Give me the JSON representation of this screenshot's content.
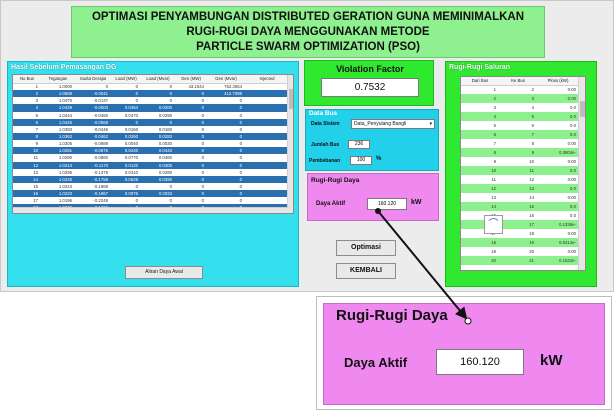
{
  "title": {
    "line1": "OPTIMASI PENYAMBUNGAN DISTRIBUTED GERATION GUNA MEMINIMALKAN",
    "line2": "RUGI-RUGI DAYA MENGGUNAKAN METODE",
    "line3": "PARTICLE SWARM OPTIMIZATION (PSO)"
  },
  "left_panel": {
    "title": "Hasil Sebelum Pemasangan DG",
    "columns": [
      "No Bus",
      "Tegangan",
      "Sudut Derajat",
      "Load (MW)",
      "Load (Mvar)",
      "Gen (MW)",
      "Gen (Mvar)",
      "Injected"
    ],
    "rows": [
      [
        "1",
        "1.0000",
        "0",
        "0",
        "0",
        "43.1544",
        "762.3564",
        ""
      ],
      [
        "2",
        "1.0668",
        "-0.0041",
        "0",
        "0",
        "0",
        "412.7098",
        ""
      ],
      [
        "3",
        "1.0470",
        "-0.0137",
        "0",
        "0",
        "0",
        "0",
        ""
      ],
      [
        "4",
        "1.0439",
        "-0.0003",
        "0.0464",
        "0.0200",
        "0",
        "0",
        ""
      ],
      [
        "5",
        "1.0444",
        "-0.0460",
        "0.0470",
        "0.0290",
        "0",
        "0",
        ""
      ],
      [
        "6",
        "1.0426",
        "-0.0568",
        "0",
        "0",
        "0",
        "0",
        ""
      ],
      [
        "7",
        "1.0393",
        "-0.0446",
        "0.0160",
        "0.0160",
        "0",
        "0",
        ""
      ],
      [
        "8",
        "1.0362",
        "-0.0462",
        "0.0260",
        "0.0283",
        "0",
        "0",
        ""
      ],
      [
        "9",
        "1.0305",
        "-0.0689",
        "0.0040",
        "0.0030",
        "0",
        "0",
        ""
      ],
      [
        "10",
        "1.0281",
        "-0.0675",
        "0.0240",
        "0.0443",
        "0",
        "0",
        ""
      ],
      [
        "11",
        "1.0290",
        "-0.0960",
        "0.0770",
        "0.0460",
        "0",
        "0",
        ""
      ],
      [
        "12",
        "1.0213",
        "-0.1170",
        "0.0120",
        "0.0300",
        "0",
        "0",
        ""
      ],
      [
        "13",
        "1.0295",
        "-0.1379",
        "0.0410",
        "0.0280",
        "0",
        "0",
        ""
      ],
      [
        "14",
        "1.0226",
        "-0.1758",
        "0.0628",
        "0.0390",
        "0",
        "0",
        ""
      ],
      [
        "15",
        "1.0224",
        "-0.1968",
        "0",
        "0",
        "0",
        "0",
        ""
      ],
      [
        "16",
        "1.0223",
        "-0.1967",
        "0.0076",
        "0.0033",
        "0",
        "0",
        ""
      ],
      [
        "17",
        "1.0196",
        "-0.2249",
        "0",
        "0",
        "0",
        "0",
        ""
      ],
      [
        "18",
        "1.0073",
        "-0.1669",
        "0",
        "0",
        "0",
        "0",
        ""
      ],
      [
        "19",
        "1.0429",
        "-0.0243",
        "0.1210",
        "0.0750",
        "0",
        "0",
        ""
      ],
      [
        "20",
        "1.0025",
        "-0.1966",
        "0.0035",
        "0.0045",
        "0",
        "0",
        ""
      ]
    ],
    "highlight_rows": [
      1,
      3,
      5,
      7,
      9,
      11,
      13,
      15,
      17,
      19
    ],
    "button_label": "Aliran Daya Awal"
  },
  "violation": {
    "label": "Violation Factor",
    "value": "0.7532"
  },
  "data_bus": {
    "title": "Data Bus",
    "data_label": "Data Sistem",
    "data_value": "Data_Penyulang Bangli",
    "jumlah_label": "Jumlah Bus",
    "jumlah_value": "236",
    "beban_label": "Pembebanan",
    "beban_value": "100",
    "beban_unit": "%"
  },
  "rugi_small": {
    "title": "Rugi-Rugi Daya",
    "label": "Daya Aktif",
    "value": "160.120",
    "unit": "kW"
  },
  "buttons": {
    "optimasi": "Optimasi",
    "kembali": "KEMBALI"
  },
  "right_panel": {
    "title": "Rugi-Rugi Saluran",
    "columns": [
      "Dari Bus",
      "Ke Bus",
      "Ploss (kW)"
    ],
    "rows": [
      [
        "1",
        "2",
        "0.00"
      ],
      [
        "2",
        "3",
        "0.00"
      ],
      [
        "3",
        "4",
        "0.0"
      ],
      [
        "4",
        "5",
        "0.0"
      ],
      [
        "5",
        "6",
        "0.0"
      ],
      [
        "6",
        "7",
        "0.0"
      ],
      [
        "7",
        "8",
        "0.00"
      ],
      [
        "8",
        "9",
        "0.3904e-"
      ],
      [
        "9",
        "10",
        "0.00"
      ],
      [
        "10",
        "11",
        "0.0"
      ],
      [
        "11",
        "12",
        "0.00"
      ],
      [
        "12",
        "13",
        "0.0"
      ],
      [
        "13",
        "14",
        "0.00"
      ],
      [
        "14",
        "15",
        "0.0"
      ],
      [
        "15",
        "16",
        "0.0"
      ],
      [
        "16",
        "17",
        "0.1336e-"
      ],
      [
        "17",
        "18",
        "0.00"
      ],
      [
        "18",
        "19",
        "0.0414e-"
      ],
      [
        "19",
        "20",
        "0.00"
      ],
      [
        "20",
        "21",
        "0.1522e-"
      ]
    ],
    "green_rows": [
      1,
      3,
      5,
      7,
      9,
      11,
      13,
      15,
      17,
      19
    ]
  },
  "zoom": {
    "title": "Rugi-Rugi Daya",
    "label": "Daya Aktif",
    "value": "160.120",
    "unit": "kW"
  }
}
